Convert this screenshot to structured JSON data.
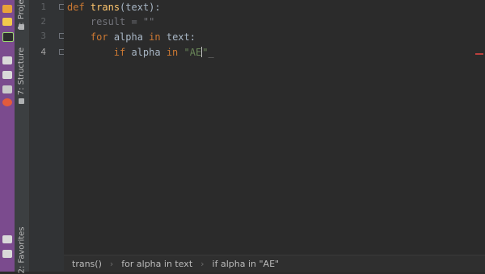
{
  "tool_windows": {
    "project": "1: Project",
    "structure": "7: Structure",
    "favorites": "2: Favorites"
  },
  "gutter": {
    "line_numbers": [
      "1",
      "2",
      "3",
      "4"
    ]
  },
  "code": {
    "line1": {
      "kw": "def",
      "fn": "trans",
      "rest": "(text):"
    },
    "line2": {
      "text": "result = \"\""
    },
    "line3": {
      "kw1": "for",
      "mid1": " alpha ",
      "kw2": "in",
      "mid2": " text:"
    },
    "line4": {
      "kw1": "if",
      "mid1": " alpha ",
      "kw2": "in",
      "str": "\"AE",
      "after": "\""
    }
  },
  "breadcrumb": {
    "items": [
      "trans()",
      "for alpha in text",
      "if alpha in \"AE\""
    ]
  },
  "colors": {
    "keyword": "#cc7832",
    "function": "#ffc66d",
    "string": "#6a8759",
    "launcher": "#7b4b8e"
  }
}
